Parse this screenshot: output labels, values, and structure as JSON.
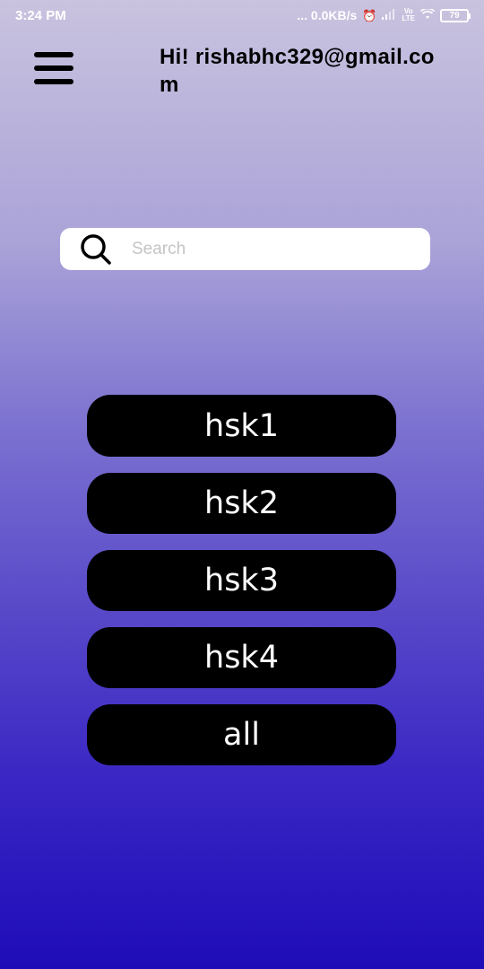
{
  "status_bar": {
    "time": "3:24 PM",
    "network_speed": "... 0.0KB/s",
    "battery": "79",
    "icons": [
      "alarm-icon",
      "signal-icon",
      "volte-icon",
      "wifi-icon",
      "battery-icon"
    ]
  },
  "header": {
    "menu_icon": "hamburger-menu-icon",
    "greeting": "Hi! rishabhc329@gmail.com"
  },
  "search": {
    "icon": "search-icon",
    "placeholder": "Search",
    "value": ""
  },
  "levels": [
    {
      "label": "hsk1"
    },
    {
      "label": "hsk2"
    },
    {
      "label": "hsk3"
    },
    {
      "label": "hsk4"
    },
    {
      "label": "all"
    }
  ],
  "colors": {
    "background_top": "#c9c3df",
    "background_bottom": "#1e0cb8",
    "button_bg": "#000000",
    "button_text": "#ffffff"
  }
}
